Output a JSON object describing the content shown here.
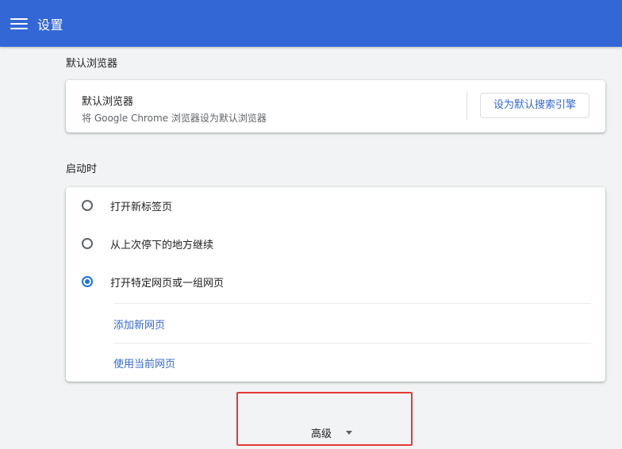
{
  "toolbar": {
    "title": "设置",
    "menu_icon": "hamburger-menu-icon"
  },
  "default_browser": {
    "section_title": "默认浏览器",
    "primary": "默认浏览器",
    "secondary": "将 Google Chrome 浏览器设为默认浏览器",
    "button_label": "设为默认搜索引擎"
  },
  "startup": {
    "section_title": "启动时",
    "options": [
      {
        "label": "打开新标签页",
        "checked": false
      },
      {
        "label": "从上次停下的地方继续",
        "checked": false
      },
      {
        "label": "打开特定网页或一组网页",
        "checked": true
      }
    ],
    "add_page": "添加新网页",
    "use_current": "使用当前网页"
  },
  "advanced": {
    "label": "高级",
    "icon": "caret-down-icon"
  },
  "colors": {
    "toolbar": "#3367d6",
    "accent": "#1a73e8",
    "highlight": "#e53935"
  }
}
